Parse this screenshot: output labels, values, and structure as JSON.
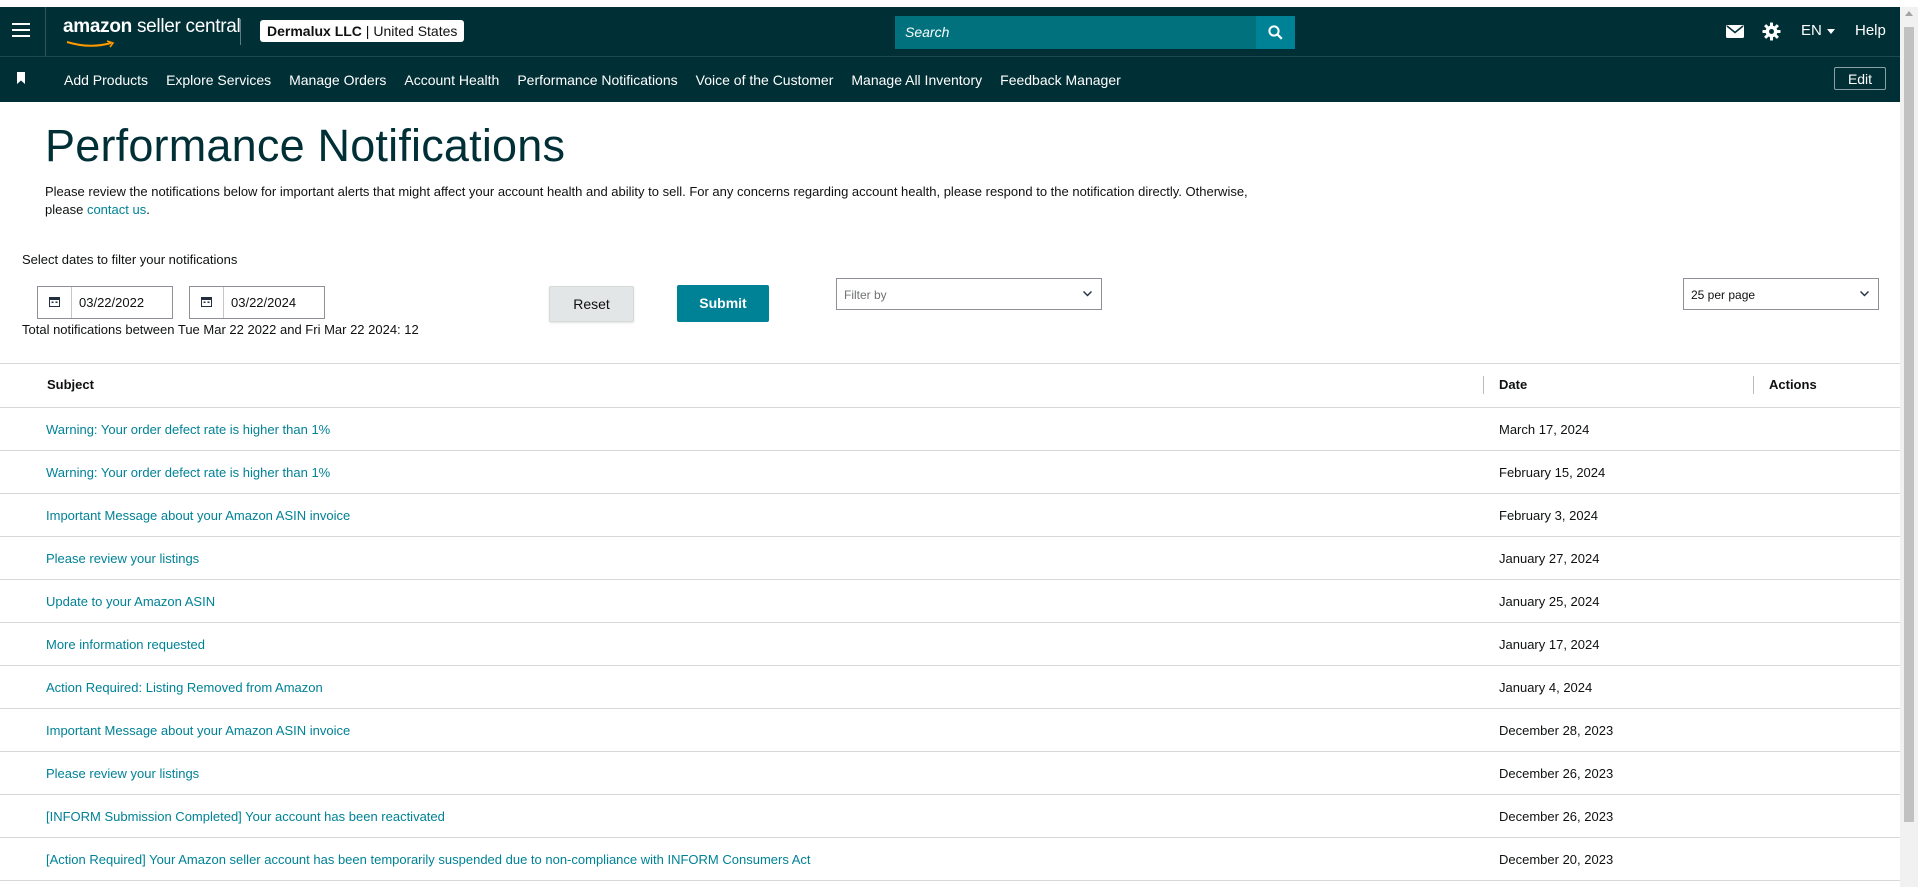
{
  "header": {
    "logo_brand": "amazon",
    "logo_suffix": "seller central",
    "account_name": "Dermalux LLC",
    "account_region": "United States",
    "search_placeholder": "Search",
    "language": "EN",
    "help": "Help",
    "icons": [
      "menu-icon",
      "search-icon",
      "mail-icon",
      "gear-icon"
    ]
  },
  "nav": {
    "items": [
      "Add Products",
      "Explore Services",
      "Manage Orders",
      "Account Health",
      "Performance Notifications",
      "Voice of the Customer",
      "Manage All Inventory",
      "Feedback Manager"
    ],
    "edit_label": "Edit",
    "icons": [
      "bookmark-icon"
    ]
  },
  "page": {
    "title": "Performance Notifications",
    "intro_text": "Please review the notifications below for important alerts that might affect your account health and ability to sell. For any concerns regarding account health, please respond to the notification directly. Otherwise, please",
    "intro_link": "contact us",
    "intro_end": "."
  },
  "filters": {
    "label": "Select dates to filter your notifications",
    "start_date": "03/22/2022",
    "end_date": "03/22/2024",
    "total_text": "Total notifications between Tue Mar 22 2022 and Fri Mar 22 2024: 12",
    "reset_label": "Reset",
    "submit_label": "Submit",
    "filter_by_placeholder": "Filter by",
    "per_page": "25 per page"
  },
  "table": {
    "columns": [
      "Subject",
      "Date",
      "Actions"
    ],
    "rows": [
      {
        "subject": "Warning: Your order defect rate is higher than 1%",
        "date": "March 17, 2024"
      },
      {
        "subject": "Warning: Your order defect rate is higher than 1%",
        "date": "February 15, 2024"
      },
      {
        "subject": "Important Message about your Amazon ASIN invoice",
        "date": "February 3, 2024"
      },
      {
        "subject": "Please review your listings",
        "date": "January 27, 2024"
      },
      {
        "subject": "Update to your Amazon ASIN",
        "date": "January 25, 2024"
      },
      {
        "subject": "More information requested",
        "date": "January 17, 2024"
      },
      {
        "subject": "Action Required: Listing Removed from Amazon",
        "date": "January 4, 2024"
      },
      {
        "subject": "Important Message about your Amazon ASIN invoice",
        "date": "December 28, 2023"
      },
      {
        "subject": "Please review your listings",
        "date": "December 26, 2023"
      },
      {
        "subject": "[INFORM Submission Completed] Your account has been reactivated",
        "date": "December 26, 2023"
      },
      {
        "subject": "[Action Required] Your Amazon seller account has been temporarily suspended due to non-compliance with INFORM Consumers Act",
        "date": "December 20, 2023"
      }
    ]
  },
  "colors": {
    "header_bg": "#002f36",
    "accent": "#008296",
    "search_bg": "#00717d"
  }
}
